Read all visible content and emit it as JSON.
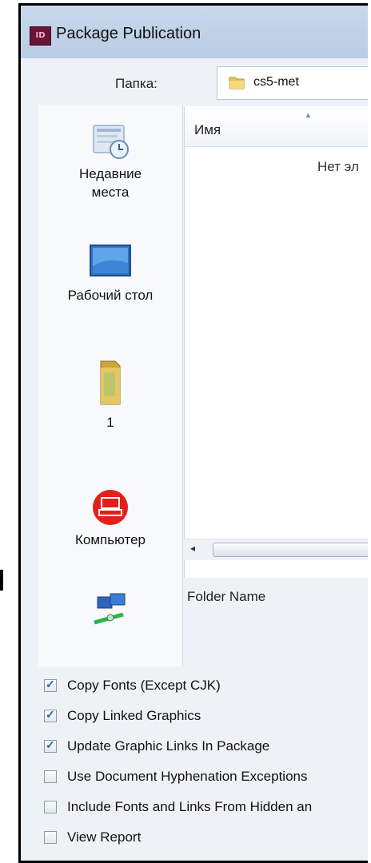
{
  "window": {
    "title": "Package Publication",
    "app_icon_text": "ID"
  },
  "folder": {
    "label": "Папка:",
    "value": "cs5-met"
  },
  "places": [
    {
      "label_lines": [
        "Недавние",
        "места"
      ],
      "icon": "recent-places-icon"
    },
    {
      "label_lines": [
        "Рабочий стол"
      ],
      "icon": "desktop-icon"
    },
    {
      "label_lines": [
        "1"
      ],
      "icon": "folder-icon"
    },
    {
      "label_lines": [
        "Компьютер"
      ],
      "icon": "computer-icon"
    },
    {
      "label_lines": [],
      "icon": "network-icon"
    }
  ],
  "file_list": {
    "column_name": "Имя",
    "empty_message": "Нет эл"
  },
  "folder_name_label": "Folder Name",
  "options": [
    {
      "label": "Copy Fonts (Except CJK)",
      "checked": true
    },
    {
      "label": "Copy Linked Graphics",
      "checked": true
    },
    {
      "label": "Update Graphic Links In Package",
      "checked": true
    },
    {
      "label": "Use Document Hyphenation Exceptions",
      "checked": false
    },
    {
      "label": "Include Fonts and Links From Hidden an",
      "checked": false
    },
    {
      "label": "View Report",
      "checked": false
    }
  ],
  "colors": {
    "titlebar": "#c7d8eb",
    "check_mark": "#2b5fa8",
    "app_icon": "#6a1436"
  }
}
